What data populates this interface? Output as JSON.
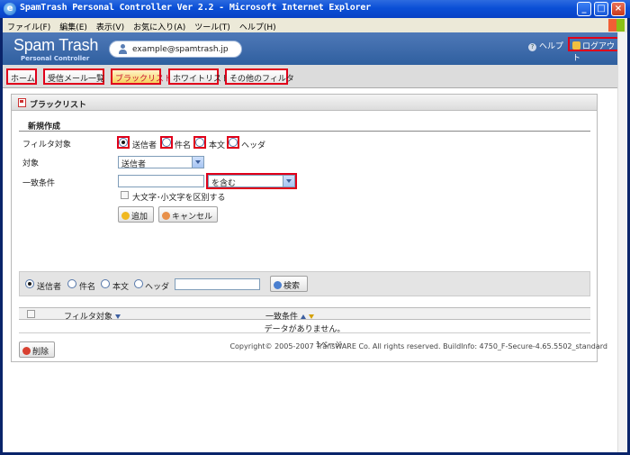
{
  "window": {
    "title": "SpamTrash Personal Controller Ver 2.2 - Microsoft Internet Explorer",
    "menu": [
      "ファイル(F)",
      "編集(E)",
      "表示(V)",
      "お気に入り(A)",
      "ツール(T)",
      "ヘルプ(H)"
    ]
  },
  "header": {
    "logo_main": "Spam Trash",
    "logo_sub": "Personal Controller",
    "user_email": "example@spamtrash.jp",
    "help_label": "ヘルプ",
    "logout_label": "ログアウト"
  },
  "tabs": [
    {
      "label": "ホーム",
      "active": false
    },
    {
      "label": "受信メール一覧",
      "active": false
    },
    {
      "label": "ブラックリスト",
      "active": true
    },
    {
      "label": "ホワイトリスト",
      "active": false
    },
    {
      "label": "その他のフィルタ",
      "active": false
    }
  ],
  "panel": {
    "title": "ブラックリスト",
    "section_title": "新規作成",
    "filter_target_label": "フィルタ対象",
    "filter_target_options": [
      "送信者",
      "件名",
      "本文",
      "ヘッダ"
    ],
    "filter_target_selected": "送信者",
    "target_label": "対象",
    "target_value": "送信者",
    "match_label": "一致条件",
    "match_input_value": "",
    "match_select_value": "を含む",
    "case_checkbox_label": "大文字･小文字を区別する",
    "add_button": "追加",
    "cancel_button": "キャンセル"
  },
  "search": {
    "options": [
      "送信者",
      "件名",
      "本文",
      "ヘッダ"
    ],
    "selected": "送信者",
    "input_value": "",
    "button_label": "検索"
  },
  "table": {
    "columns": [
      "フィルタ対象",
      "一致条件"
    ],
    "empty_message": "データがありません。",
    "pagination": "1ページ",
    "delete_button": "削除"
  },
  "footer": {
    "copyright": "Copyright© 2005-2007 TransWARE Co. All rights reserved. BuildInfo: 4750_F-Secure-4.65.5502_standard"
  },
  "colors": {
    "highlight": "#e0001a",
    "header_bg": "#3f6caf",
    "titlebar": "#0a4fd6"
  }
}
